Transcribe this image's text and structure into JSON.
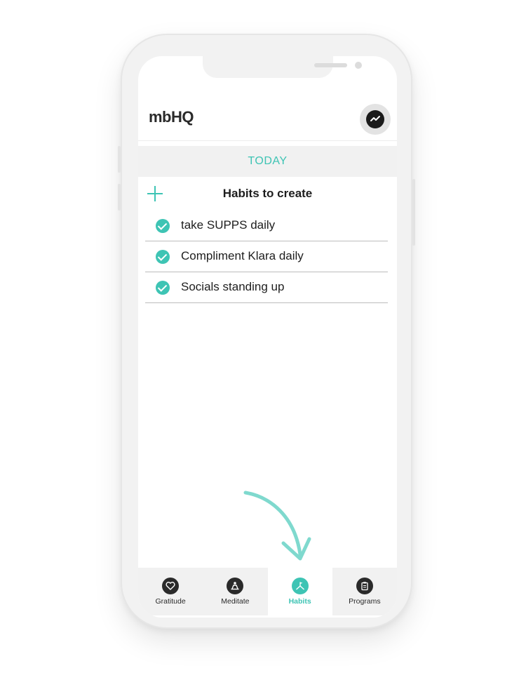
{
  "app": {
    "logo_text": "mbHQ",
    "messenger_icon": "messenger-icon"
  },
  "date_band": {
    "label": "TODAY"
  },
  "habits_section": {
    "title": "Habits to create",
    "add_icon": "plus-icon"
  },
  "habits": [
    {
      "label": "take SUPPS daily",
      "done": true
    },
    {
      "label": "Compliment Klara daily",
      "done": true
    },
    {
      "label": "Socials standing up",
      "done": true
    }
  ],
  "bottom_nav": {
    "items": [
      {
        "label": "Gratitude",
        "icon": "heart-icon",
        "active": false
      },
      {
        "label": "Meditate",
        "icon": "meditate-icon",
        "active": false
      },
      {
        "label": "Habits",
        "icon": "flag-mountain-icon",
        "active": true
      },
      {
        "label": "Programs",
        "icon": "clipboard-icon",
        "active": false
      }
    ]
  },
  "colors": {
    "accent": "#3ec4b4",
    "text": "#1e1e1e",
    "band": "#f1f1f1"
  }
}
